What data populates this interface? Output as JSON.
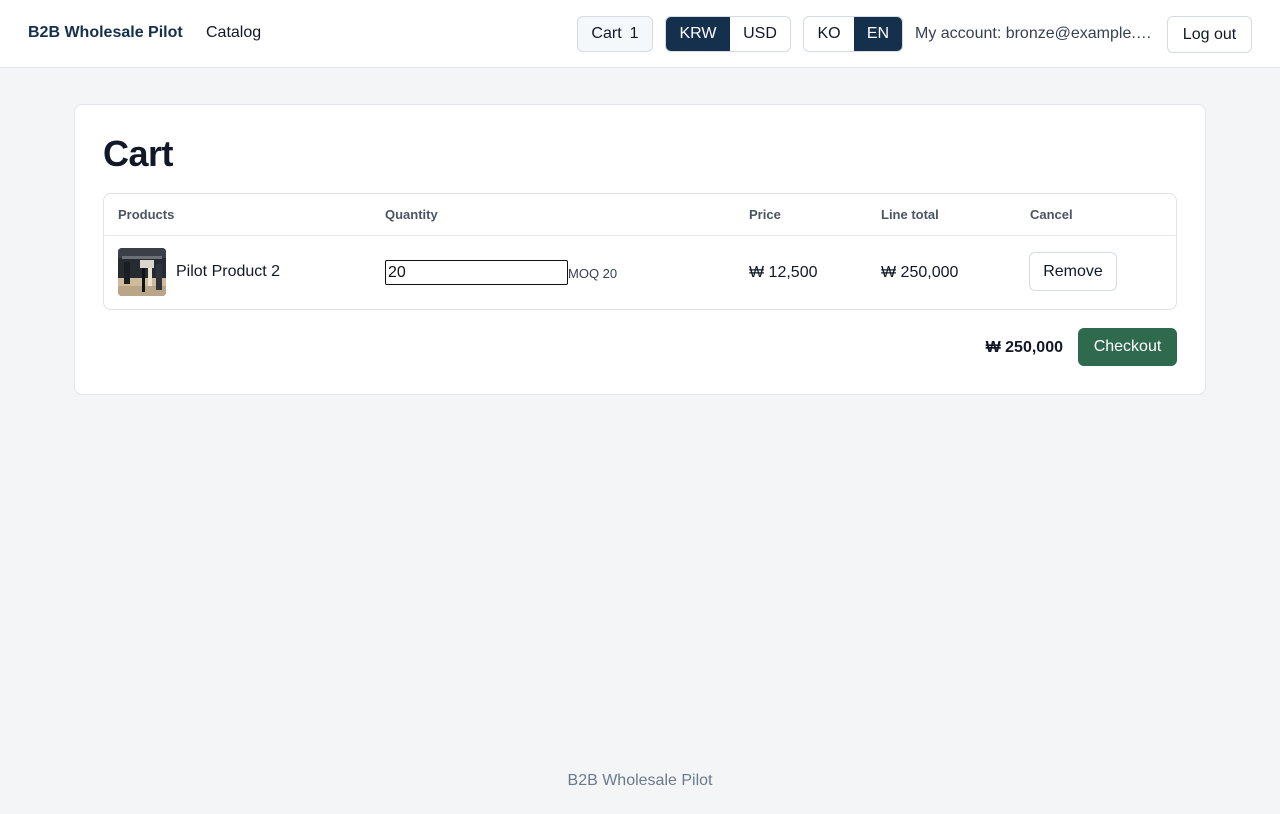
{
  "header": {
    "brand": "B2B Wholesale Pilot",
    "nav_catalog": "Catalog",
    "cart_label": "Cart",
    "cart_count": "1",
    "currency_options": [
      "KRW",
      "USD"
    ],
    "currency_selected": "KRW",
    "language_options": [
      "KO",
      "EN"
    ],
    "language_selected": "EN",
    "account_text": "My account: bronze@example.com",
    "logout_label": "Log out"
  },
  "cart": {
    "title": "Cart",
    "columns": [
      "Products",
      "Quantity",
      "Price",
      "Line total",
      "Cancel"
    ],
    "items": [
      {
        "product": "Pilot Product 2",
        "quantity": "20",
        "moq": "MOQ 20",
        "price": "₩ 12,500",
        "line_total": "₩ 250,000",
        "remove_label": "Remove"
      }
    ],
    "total": "₩ 250,000",
    "checkout_label": "Checkout"
  },
  "footer": {
    "text": "B2B Wholesale Pilot"
  },
  "colors": {
    "brand_navy": "#14304d",
    "checkout_green": "#2f6a4f",
    "page_bg": "#f3f5f7"
  }
}
